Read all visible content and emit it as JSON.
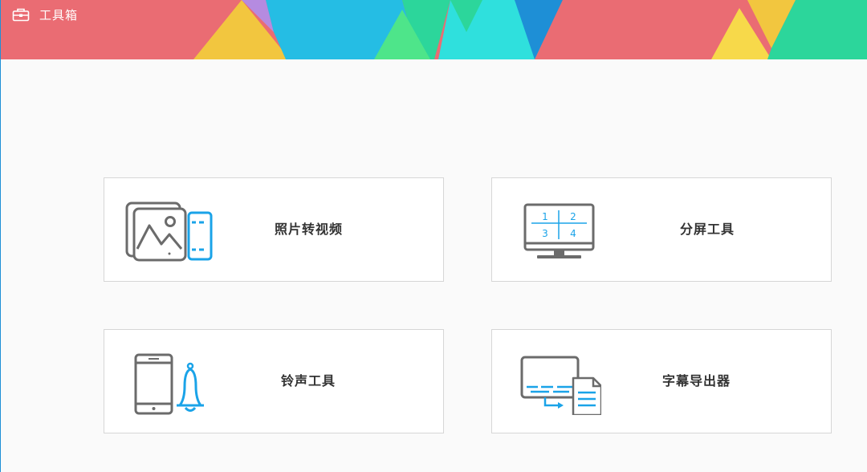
{
  "window": {
    "title": "工具箱",
    "title_icon": "toolbox-icon"
  },
  "colors": {
    "background": "#fafafa",
    "card_border": "#d6d6d6",
    "icon_gray": "#6b6b6b",
    "icon_blue": "#1aa3e8",
    "text": "#333333"
  },
  "tools": [
    {
      "label": "照片转视频",
      "icon": "photo-to-video-icon"
    },
    {
      "label": "分屏工具",
      "icon": "split-screen-icon",
      "screen_numbers": [
        "1",
        "2",
        "3",
        "4"
      ]
    },
    {
      "label": "铃声工具",
      "icon": "ringtone-icon"
    },
    {
      "label": "字幕导出器",
      "icon": "subtitle-export-icon"
    }
  ]
}
